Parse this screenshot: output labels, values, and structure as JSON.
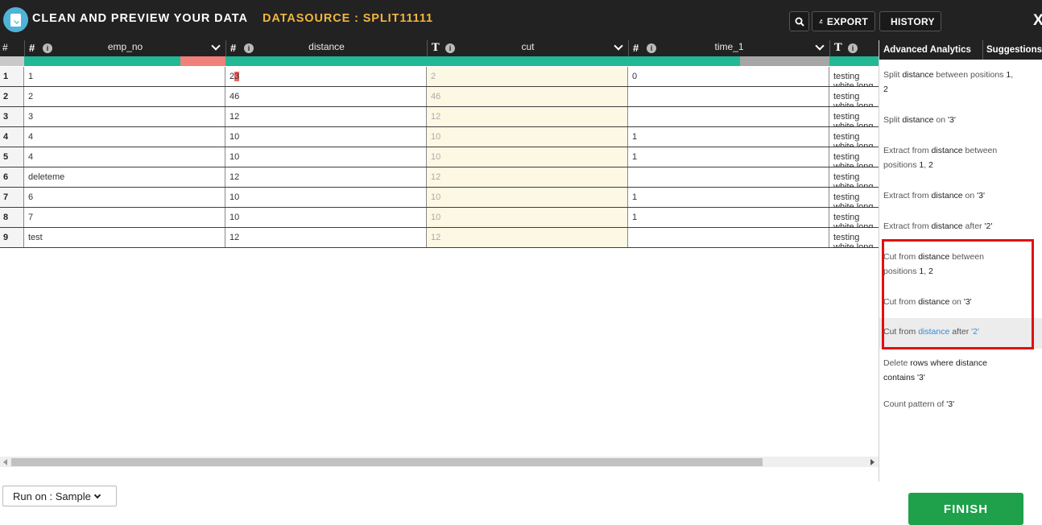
{
  "header": {
    "app_title": "CLEAN AND PREVIEW YOUR DATA",
    "datasource_title": "DATASOURCE : SPLIT11111",
    "export_label": "EXPORT",
    "history_label": "HISTORY",
    "close_label": "X",
    "icons": [
      "search-icon",
      "export-icon",
      "history-icon"
    ]
  },
  "grid": {
    "rownum_header": "#",
    "columns": [
      {
        "type": "#",
        "name": "emp_no"
      },
      {
        "type": "#",
        "name": "distance"
      },
      {
        "type": "T",
        "name": "cut"
      },
      {
        "type": "#",
        "name": "time_1"
      },
      {
        "type": "T",
        "name": ""
      }
    ],
    "quality": {
      "emp_no": {
        "valid": 0.78,
        "invalid": 0.22
      },
      "distance": {
        "valid": 1.0
      },
      "cut": {
        "valid": 1.0
      },
      "time_1": {
        "valid": 0.56,
        "empty": 0.44
      }
    },
    "rows": [
      {
        "n": "1",
        "emp_no": "1",
        "distance_a": "2",
        "distance_b": "3",
        "cut": "2",
        "time_1": "0",
        "extra": "testing white long text wh"
      },
      {
        "n": "2",
        "emp_no": "2",
        "distance": "46",
        "cut": "46",
        "time_1": "",
        "extra": "testing white long text wh"
      },
      {
        "n": "3",
        "emp_no": "3",
        "distance": "12",
        "cut": "12",
        "time_1": "",
        "extra": "testing white long text wh"
      },
      {
        "n": "4",
        "emp_no": "4",
        "distance": "10",
        "cut": "10",
        "time_1": "1",
        "extra": "testing white long text wh"
      },
      {
        "n": "5",
        "emp_no": "4",
        "distance": "10",
        "cut": "10",
        "time_1": "1",
        "extra": "testing white long text wh"
      },
      {
        "n": "6",
        "emp_no": "deleteme",
        "distance": "12",
        "cut": "12",
        "time_1": "",
        "extra": "testing white long text wh"
      },
      {
        "n": "7",
        "emp_no": "6",
        "distance": "10",
        "cut": "10",
        "time_1": "1",
        "extra": "testing white long text wh"
      },
      {
        "n": "8",
        "emp_no": "7",
        "distance": "10",
        "cut": "10",
        "time_1": "1",
        "extra": "testing white long text wh"
      },
      {
        "n": "9",
        "emp_no": "test",
        "distance": "12",
        "cut": "12",
        "time_1": "",
        "extra": "testing white long text wh"
      }
    ]
  },
  "panel": {
    "tab_analytics": "Advanced Analytics",
    "tab_suggestions": "Suggestions",
    "suggestions": [
      {
        "parts": [
          [
            "Split ",
            0
          ],
          [
            "distance",
            1
          ],
          [
            " between positions ",
            0
          ],
          [
            "1",
            1
          ],
          [
            ",",
            0
          ]
        ],
        "line2": [
          [
            "2",
            1
          ]
        ]
      },
      {
        "parts": [
          [
            "Split ",
            0
          ],
          [
            "distance",
            1
          ],
          [
            " on ",
            0
          ],
          [
            "'3'",
            1
          ]
        ]
      },
      {
        "parts": [
          [
            "Extract from ",
            0
          ],
          [
            "distance",
            1
          ],
          [
            " between",
            0
          ]
        ],
        "line2": [
          [
            "positions ",
            0
          ],
          [
            "1",
            1
          ],
          [
            ", ",
            0
          ],
          [
            "2",
            1
          ]
        ]
      },
      {
        "parts": [
          [
            "Extract from ",
            0
          ],
          [
            "distance",
            1
          ],
          [
            " on ",
            0
          ],
          [
            "'3'",
            1
          ]
        ]
      },
      {
        "parts": [
          [
            "Extract from ",
            0
          ],
          [
            "distance",
            1
          ],
          [
            " after ",
            0
          ],
          [
            "'2'",
            1
          ]
        ]
      },
      {
        "parts": [
          [
            "Cut from ",
            0
          ],
          [
            "distance",
            1
          ],
          [
            " between",
            0
          ]
        ],
        "line2": [
          [
            "positions ",
            0
          ],
          [
            "1",
            1
          ],
          [
            ", ",
            0
          ],
          [
            "2",
            1
          ]
        ]
      },
      {
        "parts": [
          [
            "Cut from ",
            0
          ],
          [
            "distance",
            1
          ],
          [
            " on ",
            0
          ],
          [
            "'3'",
            1
          ]
        ]
      },
      {
        "parts": [
          [
            "Cut from ",
            0
          ],
          [
            "distance",
            2
          ],
          [
            " after ",
            0
          ],
          [
            "'2'",
            2
          ]
        ]
      },
      {
        "parts": [
          [
            "Delete ",
            0
          ],
          [
            "rows where distance",
            1
          ]
        ],
        "line2": [
          [
            "contains ",
            1
          ],
          [
            "'3'",
            1
          ]
        ]
      },
      {
        "parts": [
          [
            "Count pattern of ",
            0
          ],
          [
            "'3'",
            1
          ]
        ]
      }
    ]
  },
  "footer": {
    "run_on_label": "Run on : Sample",
    "finish_label": "FINISH"
  }
}
